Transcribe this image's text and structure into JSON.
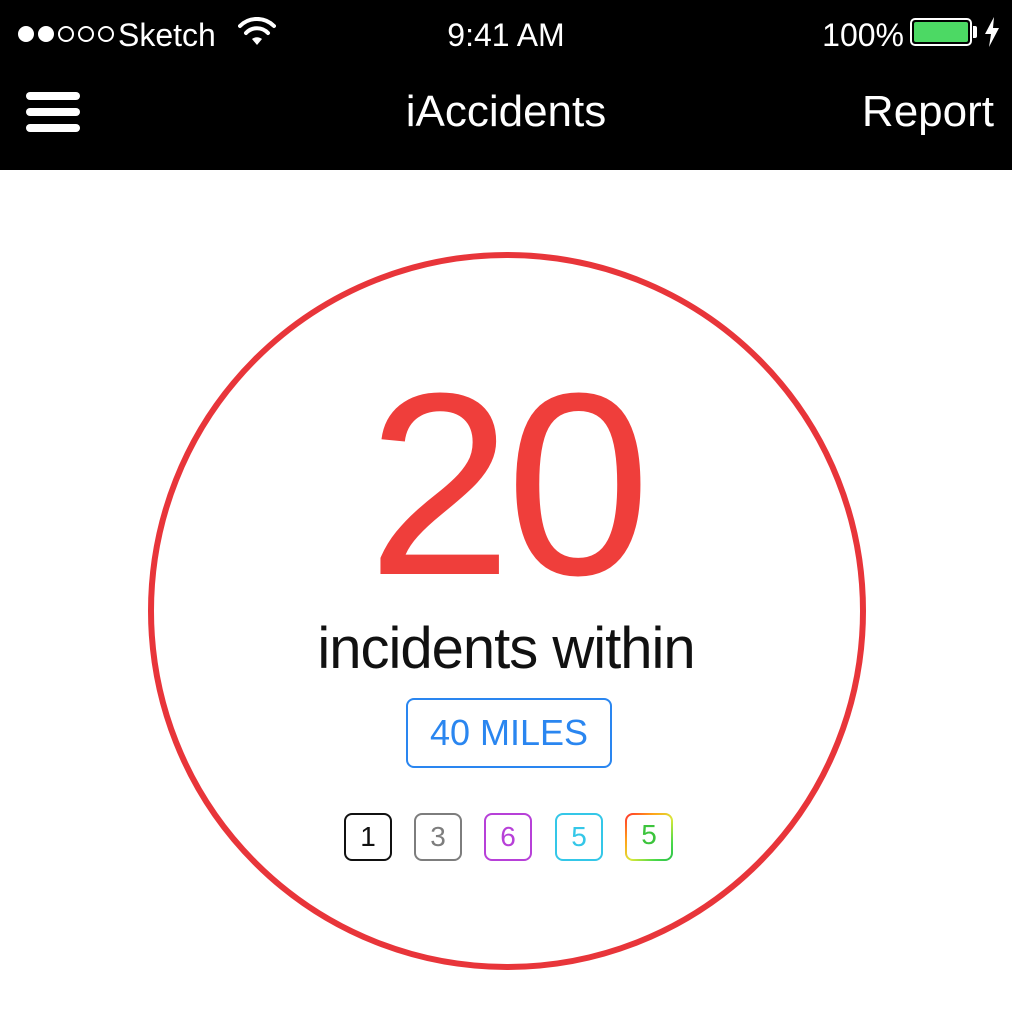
{
  "status_bar": {
    "signal_dots_filled": 2,
    "signal_dots_total": 5,
    "carrier": "Sketch",
    "wifi_icon": "wifi-icon",
    "time": "9:41 AM",
    "battery_percent": "100%",
    "battery_level": 1.0,
    "battery_color": "#4cd964",
    "charging_icon": "bolt-icon"
  },
  "nav_bar": {
    "menu_icon": "hamburger-menu-icon",
    "title": "iAccidents",
    "report_label": "Report"
  },
  "summary": {
    "count": "20",
    "count_color": "#ef3e3b",
    "ring_color": "#e8353a",
    "subtitle": "incidents within",
    "radius_label": "40 MILES",
    "radius_color": "#2a86f0"
  },
  "category_badges": [
    {
      "value": "1",
      "color": "#111111"
    },
    {
      "value": "3",
      "color": "#7d7d7d"
    },
    {
      "value": "6",
      "color": "#b740d8"
    },
    {
      "value": "5",
      "color": "#34c7e8"
    },
    {
      "value": "5",
      "color": "rainbow-gradient"
    }
  ]
}
